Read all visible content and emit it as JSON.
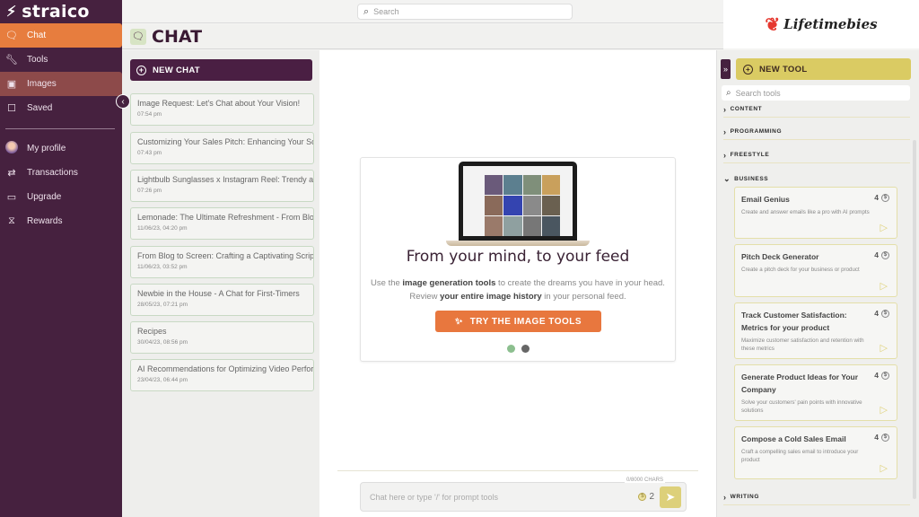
{
  "brand": {
    "name": "straico",
    "icon": "bolt-icon"
  },
  "sidebar": {
    "items": [
      {
        "label": "Chat",
        "icon": "chat-bubble-icon",
        "state": "active"
      },
      {
        "label": "Tools",
        "icon": "wrench-icon",
        "state": "default"
      },
      {
        "label": "Images",
        "icon": "image-icon",
        "state": "hover"
      },
      {
        "label": "Saved",
        "icon": "bookmark-icon",
        "state": "default"
      }
    ],
    "account_items": [
      {
        "label": "My profile",
        "icon": "avatar-icon"
      },
      {
        "label": "Transactions",
        "icon": "arrows-swap-icon"
      },
      {
        "label": "Upgrade",
        "icon": "card-icon"
      },
      {
        "label": "Rewards",
        "icon": "hourglass-icon"
      }
    ]
  },
  "topbar": {
    "search_placeholder": "Search"
  },
  "watermark": {
    "name": "Lifetimebies"
  },
  "header": {
    "title": "CHAT"
  },
  "chats": {
    "new_chat_label": "NEW CHAT",
    "items": [
      {
        "title": "Image Request: Let's Chat about Your Vision!",
        "date": "07:54 pm"
      },
      {
        "title": "Customizing Your Sales Pitch: Enhancing Your Sc",
        "date": "07:43 pm"
      },
      {
        "title": "Lightbulb Sunglasses x Instagram Reel: Trendy ar",
        "date": "07:26 pm"
      },
      {
        "title": "Lemonade: The Ultimate Refreshment - From Blo",
        "date": "11/06/23, 04:20 pm"
      },
      {
        "title": "From Blog to Screen: Crafting a Captivating Scrip",
        "date": "11/06/23, 03:52 pm"
      },
      {
        "title": "Newbie in the House - A Chat for First-Timers",
        "date": "28/05/23, 07:21 pm"
      },
      {
        "title": "Recipes",
        "date": "30/04/23, 08:56 pm"
      },
      {
        "title": "AI Recommendations for Optimizing Video Perfor",
        "date": "23/04/23, 06:44 pm"
      }
    ]
  },
  "promo": {
    "headline": "From your mind, to your feed",
    "line1_pre": "Use the ",
    "line1_bold": "image generation tools",
    "line1_post": " to create the dreams you have in your head.",
    "line2_pre": "Review ",
    "line2_bold": "your entire image history",
    "line2_post": " in your personal feed.",
    "button_label": "TRY THE IMAGE TOOLS",
    "carousel": {
      "count": 2,
      "active": 1
    },
    "colors": {
      "active_dot": "#8cbf8f",
      "inactive_dot": "#666666",
      "button": "#e8773e"
    }
  },
  "composer": {
    "placeholder": "Chat here or type '/' for prompt tools",
    "char_count": "0/8000 CHARS",
    "credits": "2"
  },
  "tools": {
    "new_tool_label": "NEW TOOL",
    "search_placeholder": "Search tools",
    "categories": [
      {
        "label": "CONTENT",
        "expanded": false
      },
      {
        "label": "PROGRAMMING",
        "expanded": false
      },
      {
        "label": "FREESTYLE",
        "expanded": false
      },
      {
        "label": "BUSINESS",
        "expanded": true
      },
      {
        "label": "WRITING",
        "expanded": false
      }
    ],
    "business_tools": [
      {
        "title": "Email Genius",
        "desc": "Create and answer emails like a pro with AI prompts",
        "cost": "4"
      },
      {
        "title": "Pitch Deck Generator",
        "desc": "Create a pitch deck for your business or product",
        "cost": "4"
      },
      {
        "title": "Track Customer Satisfaction: Metrics for your product",
        "desc": "Maximize customer satisfaction and retention with these metrics",
        "cost": "4"
      },
      {
        "title": "Generate Product Ideas for Your Company",
        "desc": "Solve your customers' pain points with innovative solutions",
        "cost": "4"
      },
      {
        "title": "Compose a Cold Sales Email",
        "desc": "Craft a compelling sales email to introduce your product",
        "cost": "4"
      }
    ]
  },
  "colors": {
    "sidebar": "#46213f",
    "accent": "#e77d3e",
    "tool_accent": "#dacb63"
  }
}
